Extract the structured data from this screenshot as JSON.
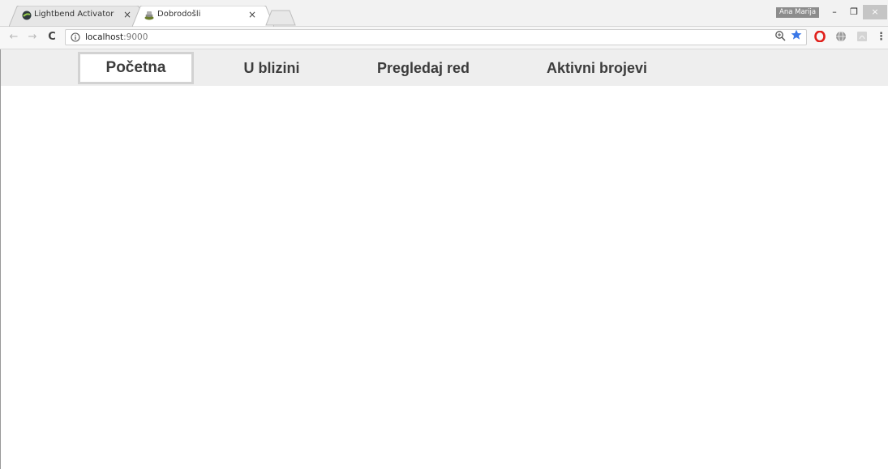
{
  "browser": {
    "tabs": [
      {
        "title": "Lightbend Activator",
        "close": "×",
        "icon": "lightbend-icon",
        "active": false
      },
      {
        "title": "Dobrodošli",
        "close": "×",
        "icon": "play-framework-icon",
        "active": true
      }
    ],
    "profile_name": "Ana Marija",
    "window_controls": {
      "minimize": "–",
      "maximize": "❐",
      "close": "×"
    },
    "toolbar": {
      "back": "←",
      "forward": "→",
      "reload": "C",
      "url_host": "localhost",
      "url_port": ":9000",
      "menu": "⋮"
    },
    "colors": {
      "star": "#3b78e7",
      "opera": "#e0201b",
      "tab_strip": "#f2f2f2",
      "nav_background": "#eeeeee"
    }
  },
  "page": {
    "nav": [
      {
        "label": "Početna",
        "active": true
      },
      {
        "label": "U blizini",
        "active": false
      },
      {
        "label": "Pregledaj red",
        "active": false
      },
      {
        "label": "Aktivni brojevi",
        "active": false
      }
    ]
  }
}
